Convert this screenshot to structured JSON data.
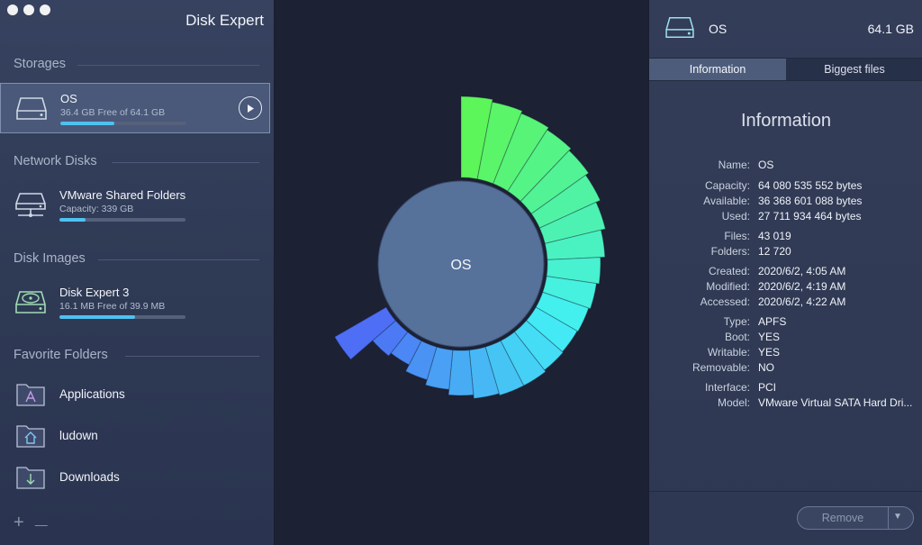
{
  "window": {
    "title": "Disk Expert"
  },
  "sidebar": {
    "sections": {
      "storages": "Storages",
      "network": "Network Disks",
      "images": "Disk Images",
      "favorites": "Favorite Folders"
    },
    "storages": [
      {
        "name": "OS",
        "sub": "36.4 GB Free of 64.1 GB",
        "fill": 0.43,
        "icon": "hard-drive-icon"
      }
    ],
    "network": [
      {
        "name": "VMware Shared Folders",
        "sub": "Capacity: 339 GB",
        "fill": 0.21,
        "icon": "network-drive-icon"
      }
    ],
    "images": [
      {
        "name": "Disk Expert 3",
        "sub": "16.1 MB Free of 39.9 MB",
        "fill": 0.6,
        "icon": "disk-image-icon"
      }
    ],
    "favorites": [
      {
        "label": "Applications",
        "icon": "applications-folder-icon"
      },
      {
        "label": "ludown",
        "icon": "home-folder-icon"
      },
      {
        "label": "Downloads",
        "icon": "downloads-folder-icon"
      }
    ],
    "add_label": "+",
    "remove_label": "—"
  },
  "center": {
    "disk_label": "OS",
    "colors": {
      "hub": "#56719a",
      "green": "#5cf55a",
      "cyan": "#42f0f5",
      "blue": "#4d6ef5"
    }
  },
  "right": {
    "disk_name": "OS",
    "disk_size": "64.1 GB",
    "tabs": [
      {
        "label": "Information",
        "active": true
      },
      {
        "label": "Biggest files",
        "active": false
      }
    ],
    "info_title": "Information",
    "rows": [
      {
        "k": "Name:",
        "v": "OS"
      },
      {
        "k": "Capacity:",
        "v": "64 080 535 552 bytes"
      },
      {
        "k": "Available:",
        "v": "36 368 601 088 bytes"
      },
      {
        "k": "Used:",
        "v": "27 711 934 464 bytes"
      },
      {
        "k": "Files:",
        "v": "43 019"
      },
      {
        "k": "Folders:",
        "v": "12 720"
      },
      {
        "k": "Created:",
        "v": "2020/6/2, 4:05 AM"
      },
      {
        "k": "Modified:",
        "v": "2020/6/2, 4:19 AM"
      },
      {
        "k": "Accessed:",
        "v": "2020/6/2, 4:22 AM"
      },
      {
        "k": "Type:",
        "v": "APFS"
      },
      {
        "k": "Boot:",
        "v": "YES"
      },
      {
        "k": "Writable:",
        "v": "YES"
      },
      {
        "k": "Removable:",
        "v": "NO"
      },
      {
        "k": "Interface:",
        "v": "PCI"
      },
      {
        "k": "Model:",
        "v": "VMware Virtual SATA Hard Dri..."
      }
    ],
    "remove_button": "Remove",
    "dropdown_caret": "▼"
  }
}
